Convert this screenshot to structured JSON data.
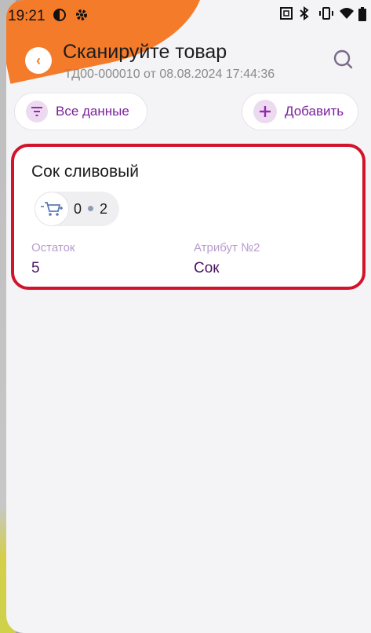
{
  "status_bar": {
    "time": "19:21"
  },
  "header": {
    "back_label": "‹",
    "title": "Сканируйте товар",
    "subtitle": "ТД00-000010 от 08.08.2024 17:44:36"
  },
  "toolbar": {
    "filter_label": "Все данные",
    "add_label": "Добавить"
  },
  "card": {
    "name": "Сок сливовый",
    "qty_scanned": "0",
    "qty_total": "2",
    "fields": [
      {
        "label": "Остаток",
        "value": "5"
      },
      {
        "label": "Атрибут №2",
        "value": "Сок"
      }
    ]
  },
  "colors": {
    "accent_orange": "#f47b2a",
    "accent_purple": "#9b27b0",
    "card_border_red": "#d1132b"
  },
  "icons": [
    "theme-icon",
    "gear-icon",
    "nfc-icon",
    "bluetooth-icon",
    "vibrate-icon",
    "wifi-icon",
    "battery-icon",
    "back-icon",
    "search-icon",
    "filter-icon",
    "plus-icon",
    "cart-icon"
  ]
}
